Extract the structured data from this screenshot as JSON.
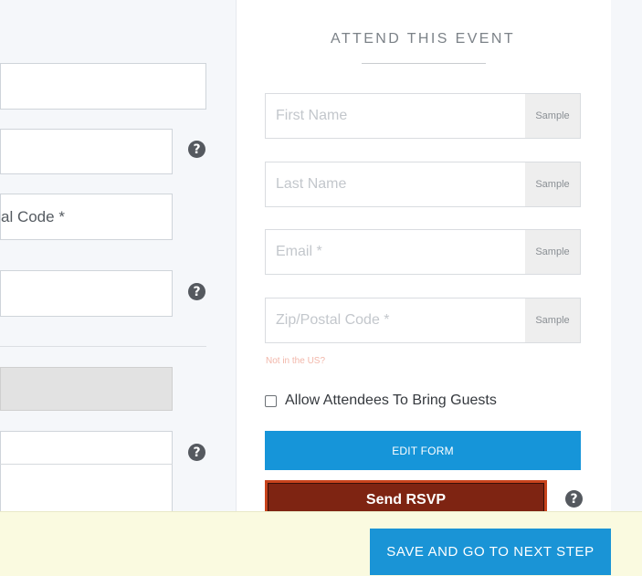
{
  "left_form": {
    "postal_fragment": "al Code *",
    "help_glyph": "?"
  },
  "event_panel": {
    "title": "ATTEND THIS EVENT",
    "fields": [
      {
        "placeholder": "First Name",
        "tag": "Sample"
      },
      {
        "placeholder": "Last Name",
        "tag": "Sample"
      },
      {
        "placeholder": "Email *",
        "tag": "Sample"
      },
      {
        "placeholder": "Zip/Postal Code *",
        "tag": "Sample"
      }
    ],
    "not_in_us": "Not in the US?",
    "allow_guests_label": "Allow Attendees To Bring Guests",
    "edit_form_label": "EDIT FORM",
    "send_rsvp_label": "Send RSVP"
  },
  "footer": {
    "save_next_label": "SAVE AND GO TO NEXT STEP"
  },
  "colors": {
    "accent_blue": "#1695d9",
    "rsvp_border": "#c8431c",
    "rsvp_fill": "#7e2412",
    "footer_bg": "#fafae0"
  }
}
